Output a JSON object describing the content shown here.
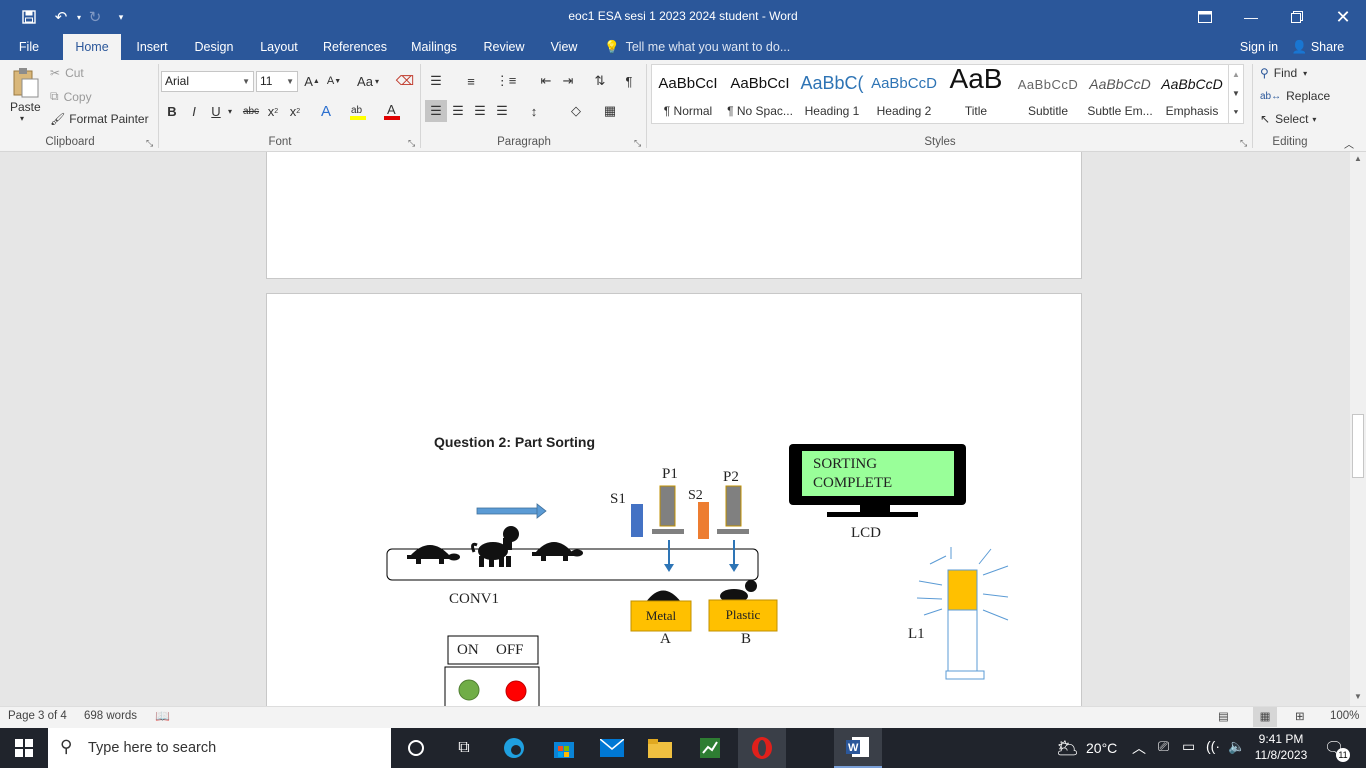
{
  "window": {
    "title": "eoc1 ESA sesi 1 2023 2024 student - Word"
  },
  "tabs": [
    "File",
    "Home",
    "Insert",
    "Design",
    "Layout",
    "References",
    "Mailings",
    "Review",
    "View"
  ],
  "active_tab": "Home",
  "tell_me": "Tell me what you want to do...",
  "account": {
    "sign_in": "Sign in",
    "share": "Share"
  },
  "clipboard": {
    "paste": "Paste",
    "cut": "Cut",
    "copy": "Copy",
    "format_painter": "Format Painter",
    "label": "Clipboard"
  },
  "font": {
    "name": "Arial",
    "size": "11",
    "label": "Font",
    "case_label": "Aa"
  },
  "paragraph": {
    "label": "Paragraph"
  },
  "styles": {
    "label": "Styles",
    "items": [
      {
        "preview": "AaBbCcI",
        "name": "¶ Normal"
      },
      {
        "preview": "AaBbCcI",
        "name": "¶ No Spac..."
      },
      {
        "preview": "AaBbC(",
        "name": "Heading 1"
      },
      {
        "preview": "AaBbCcD",
        "name": "Heading 2"
      },
      {
        "preview": "AaB",
        "name": "Title"
      },
      {
        "preview": "AaBbCcD",
        "name": "Subtitle"
      },
      {
        "preview": "AaBbCcD",
        "name": "Subtle Em..."
      },
      {
        "preview": "AaBbCcD",
        "name": "Emphasis"
      }
    ]
  },
  "editing": {
    "label": "Editing",
    "find": "Find",
    "replace": "Replace",
    "select": "Select"
  },
  "document": {
    "question_title": "Question 2: Part Sorting",
    "lcd_text_line1": "SORTING",
    "lcd_text_line2": "COMPLETE",
    "lcd_label": "LCD",
    "conveyor_label": "CONV1",
    "s1": "S1",
    "s2": "S2",
    "p1": "P1",
    "p2": "P2",
    "bin_metal": "Metal",
    "bin_plastic": "Plastic",
    "bin_a": "A",
    "bin_b": "B",
    "lamp_label": "L1",
    "on_label": "ON",
    "off_label": "OFF"
  },
  "status": {
    "page": "Page 3 of 4",
    "words": "698 words",
    "zoom": "100%"
  },
  "taskbar": {
    "search_placeholder": "Type here to search",
    "temperature": "20°C",
    "time": "9:41 PM",
    "date": "11/8/2023",
    "notifications": "11"
  },
  "colors": {
    "word_blue": "#2b579a",
    "lcd_green": "#99ff99",
    "bin_yellow": "#ffc000",
    "lamp_yellow": "#ffc000",
    "sensor1": "#4472c4",
    "sensor2": "#ed7d31",
    "on_green": "#70ad47",
    "off_red": "#ff0000"
  }
}
